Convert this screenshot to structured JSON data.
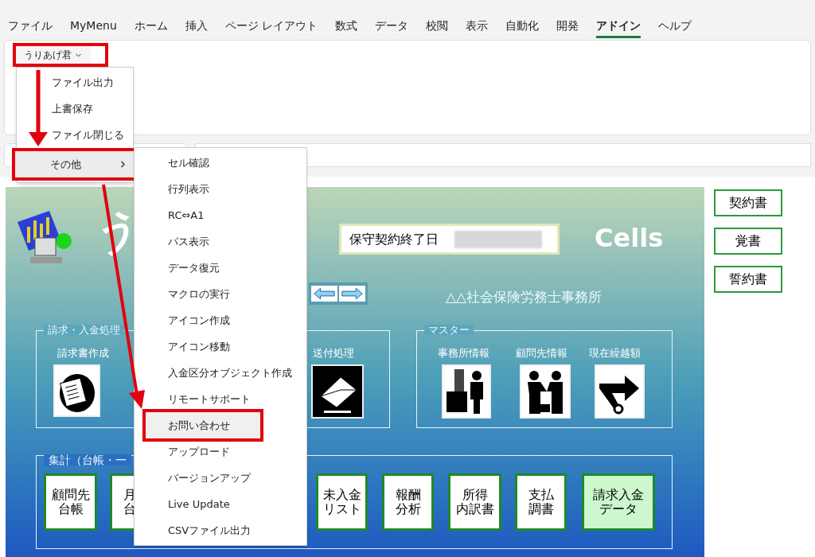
{
  "ribbon_tabs": [
    {
      "label": "ファイル",
      "selected": false
    },
    {
      "label": "MyMenu",
      "selected": false
    },
    {
      "label": "ホーム",
      "selected": false
    },
    {
      "label": "挿入",
      "selected": false
    },
    {
      "label": "ページ レイアウト",
      "selected": false
    },
    {
      "label": "数式",
      "selected": false
    },
    {
      "label": "データ",
      "selected": false
    },
    {
      "label": "校閲",
      "selected": false
    },
    {
      "label": "表示",
      "selected": false
    },
    {
      "label": "自動化",
      "selected": false
    },
    {
      "label": "開発",
      "selected": false
    },
    {
      "label": "アドイン",
      "selected": true
    },
    {
      "label": "ヘルプ",
      "selected": false
    }
  ],
  "ribbon_button": {
    "label": "うりあげ君",
    "annotated": true
  },
  "dropdown_menu": [
    {
      "label": "ファイル出力",
      "selected": false,
      "annotated": false,
      "submenu": false
    },
    {
      "label": "上書保存",
      "selected": false,
      "annotated": false,
      "submenu": false
    },
    {
      "label": "ファイル閉じる",
      "selected": false,
      "annotated": false,
      "submenu": false
    },
    {
      "label": "その他",
      "selected": true,
      "annotated": true,
      "submenu": true
    }
  ],
  "submenu": [
    {
      "label": "セル確認",
      "selected": false,
      "annotated": false
    },
    {
      "label": "行列表示",
      "selected": false,
      "annotated": false
    },
    {
      "label": "RC⇔A1",
      "selected": false,
      "annotated": false
    },
    {
      "label": "パス表示",
      "selected": false,
      "annotated": false
    },
    {
      "label": "データ復元",
      "selected": false,
      "annotated": false
    },
    {
      "label": "マクロの実行",
      "selected": false,
      "annotated": false
    },
    {
      "label": "アイコン作成",
      "selected": false,
      "annotated": false
    },
    {
      "label": "アイコン移動",
      "selected": false,
      "annotated": false
    },
    {
      "label": "入金区分オブジェクト作成",
      "selected": false,
      "annotated": false
    },
    {
      "label": "リモートサポート",
      "selected": false,
      "annotated": false
    },
    {
      "label": "お問い合わせ",
      "selected": true,
      "annotated": true
    },
    {
      "label": "アップロード",
      "selected": false,
      "annotated": false
    },
    {
      "label": "バージョンアップ",
      "selected": false,
      "annotated": false
    },
    {
      "label": "Live Update",
      "selected": false,
      "annotated": false
    },
    {
      "label": "CSVファイル出力",
      "selected": false,
      "annotated": false
    }
  ],
  "sheet": {
    "title": "う",
    "contract_field": {
      "label": "保守契約終了日"
    },
    "brand": "Cells",
    "office_name": "△△社会保険労務士事務所",
    "groups": [
      {
        "title": "請求・入金処理",
        "items": [
          {
            "label": "請求書作成",
            "kind": "documents"
          },
          {
            "label": "送付処理",
            "kind": "envelope"
          }
        ]
      },
      {
        "title": "マスター",
        "items": [
          {
            "label": "事務所情報",
            "kind": "office"
          },
          {
            "label": "顧問先情報",
            "kind": "handshake"
          },
          {
            "label": "現在繰越額",
            "kind": "arrow"
          }
        ]
      }
    ],
    "summary": {
      "title": "集計（台帳・一",
      "buttons": [
        {
          "lines": [
            "顧問先",
            "台帳"
          ],
          "selected": false
        },
        {
          "lines": [
            "月",
            "台"
          ],
          "selected": false
        },
        {
          "lines": [
            "未入金",
            "リスト"
          ],
          "selected": false
        },
        {
          "lines": [
            "報酬",
            "分析"
          ],
          "selected": false
        },
        {
          "lines": [
            "所得",
            "内訳書"
          ],
          "selected": false
        },
        {
          "lines": [
            "支払",
            "調書"
          ],
          "selected": false
        },
        {
          "lines": [
            "請求入金",
            "データ"
          ],
          "selected": true
        }
      ]
    }
  },
  "side_buttons": [
    "契約書",
    "覚書",
    "誓約書"
  ]
}
